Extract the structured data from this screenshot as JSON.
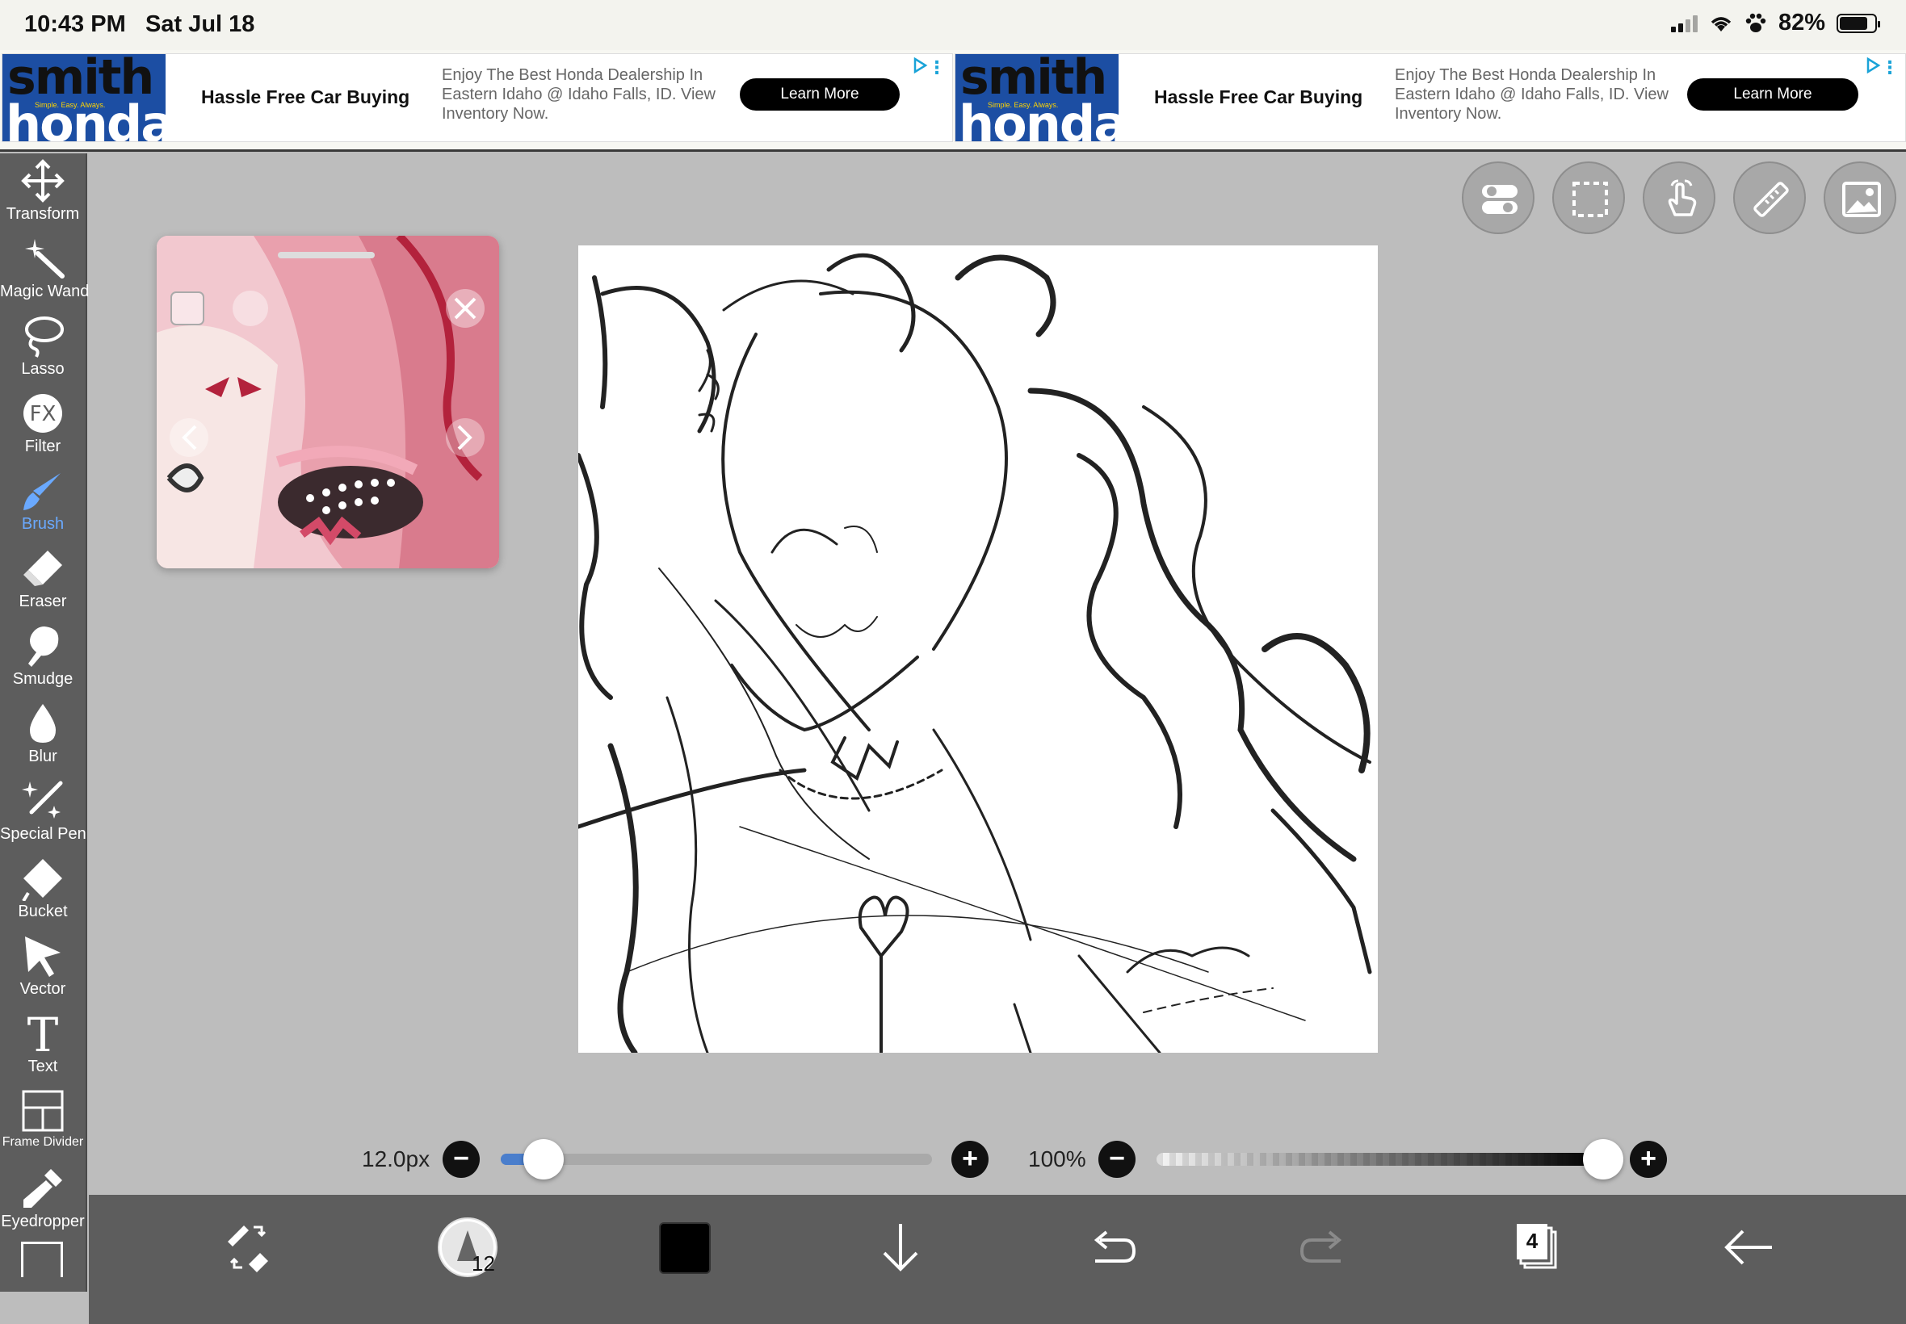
{
  "status_bar": {
    "time": "10:43 PM",
    "date": "Sat Jul 18",
    "battery_percent_label": "82%",
    "battery_level": 0.82
  },
  "ads": [
    {
      "brand_top": "smith",
      "brand_bottom": "honda",
      "tagline": "Simple. Easy. Always.",
      "headline": "Hassle Free Car Buying",
      "description": "Enjoy The Best Honda Dealership In Eastern Idaho @ Idaho Falls, ID. View Inventory Now.",
      "cta": "Learn More"
    },
    {
      "brand_top": "smith",
      "brand_bottom": "honda",
      "tagline": "Simple. Easy. Always.",
      "headline": "Hassle Free Car Buying",
      "description": "Enjoy The Best Honda Dealership In Eastern Idaho @ Idaho Falls, ID. View Inventory Now.",
      "cta": "Learn More"
    }
  ],
  "tools": [
    {
      "label": "Transform",
      "icon": "move-arrows-icon"
    },
    {
      "label": "Magic Wand",
      "icon": "magic-wand-icon"
    },
    {
      "label": "Lasso",
      "icon": "lasso-icon"
    },
    {
      "label": "Filter",
      "icon": "fx-icon",
      "glyph": "FX"
    },
    {
      "label": "Brush",
      "icon": "brush-icon",
      "active": true
    },
    {
      "label": "Eraser",
      "icon": "eraser-icon"
    },
    {
      "label": "Smudge",
      "icon": "smudge-icon"
    },
    {
      "label": "Blur",
      "icon": "droplet-icon"
    },
    {
      "label": "Special Pen",
      "icon": "sparkle-pen-icon"
    },
    {
      "label": "Bucket",
      "icon": "bucket-icon"
    },
    {
      "label": "Vector",
      "icon": "cursor-arrow-icon"
    },
    {
      "label": "Text",
      "icon": "text-icon",
      "glyph": "T"
    },
    {
      "label": "Frame Divider",
      "icon": "frame-divider-icon"
    },
    {
      "label": "Eyedropper",
      "icon": "eyedropper-icon"
    }
  ],
  "top_buttons": [
    {
      "name": "toggle-icon"
    },
    {
      "name": "selection-icon"
    },
    {
      "name": "hand-touch-icon"
    },
    {
      "name": "ruler-icon"
    },
    {
      "name": "image-reference-icon"
    }
  ],
  "brush_size": {
    "label": "12.0px",
    "value": 12.0,
    "fraction": 0.1
  },
  "opacity": {
    "label": "100%",
    "value": 100
  },
  "bottom_bar": {
    "brush_size_badge": "12",
    "current_color": "#000000",
    "layer_count": "4"
  },
  "colors": {
    "accent": "#6aa9ff",
    "toolbar_bg": "#5d5d5d",
    "workspace_bg": "#bdbdbd",
    "ad_logo_blue": "#1c4ea3"
  }
}
